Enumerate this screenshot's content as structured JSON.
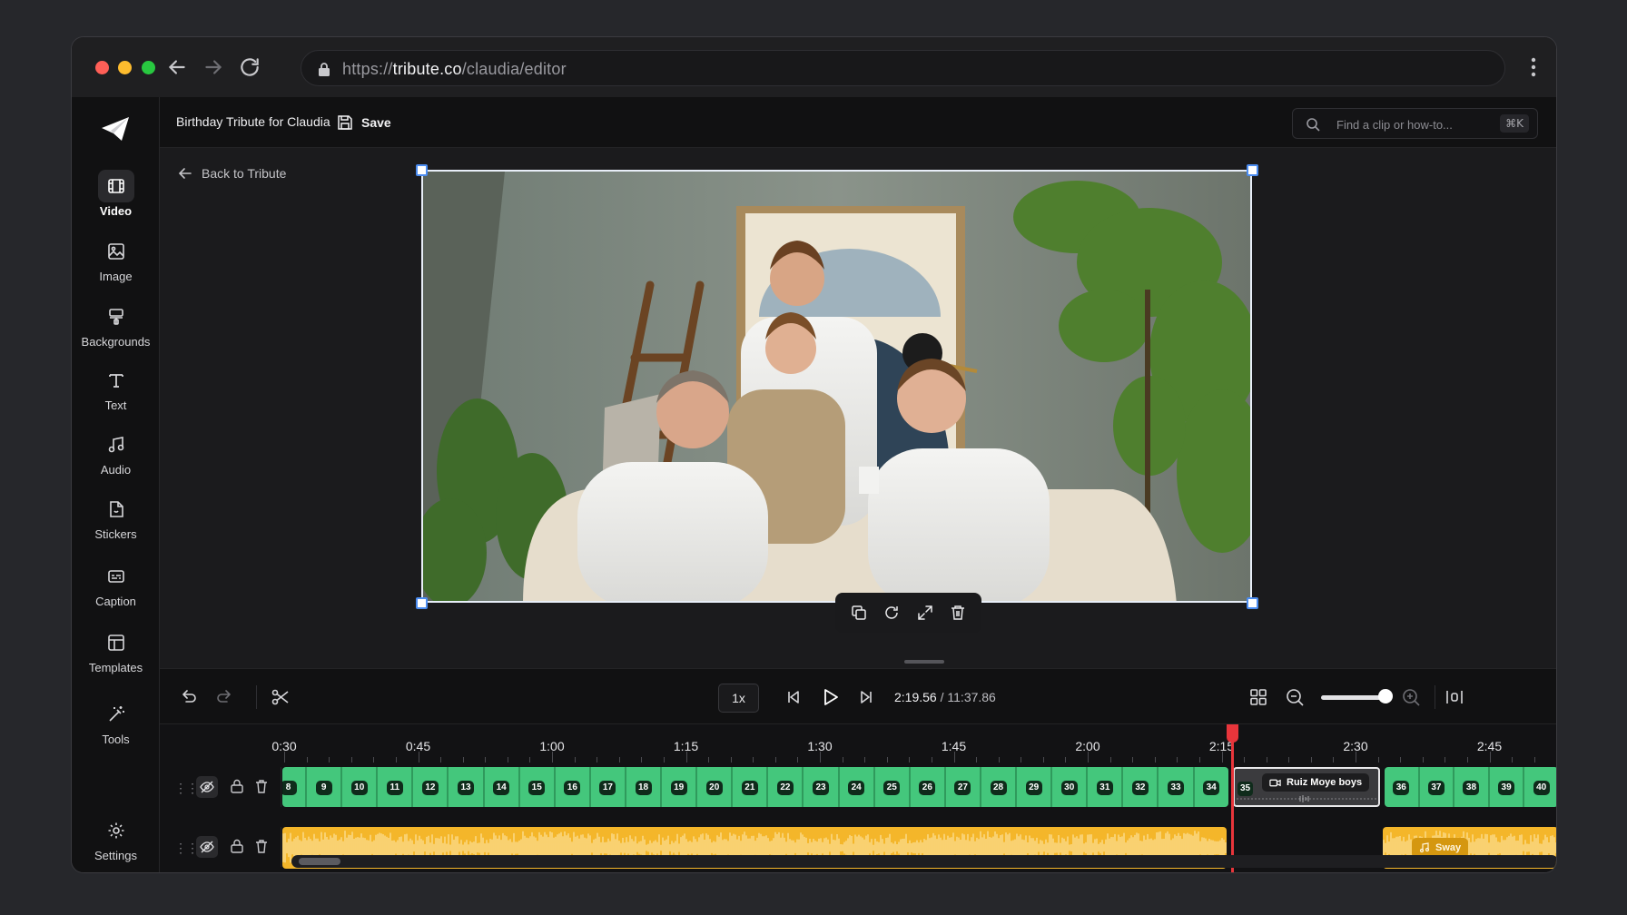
{
  "browser": {
    "url_domain": "tribute.co",
    "url_prefix": "https://",
    "url_path": "/claudia/editor"
  },
  "sidebar": {
    "items": [
      {
        "label": "Video",
        "icon": "film-icon",
        "active": true
      },
      {
        "label": "Image",
        "icon": "image-icon"
      },
      {
        "label": "Backgrounds",
        "icon": "paint-roller-icon"
      },
      {
        "label": "Text",
        "icon": "text-icon"
      },
      {
        "label": "Audio",
        "icon": "music-note-icon"
      },
      {
        "label": "Stickers",
        "icon": "sticker-icon"
      },
      {
        "label": "Caption",
        "icon": "caption-icon"
      },
      {
        "label": "Templates",
        "icon": "template-icon"
      },
      {
        "label": "Tools",
        "icon": "magic-wand-icon"
      }
    ],
    "settings_label": "Settings"
  },
  "topbar": {
    "project_title": "Birthday Tribute for Claudia",
    "save_label": "Save",
    "search_placeholder": "Find a clip or how-to...",
    "search_shortcut": "⌘K"
  },
  "canvas": {
    "back_label": "Back to Tribute"
  },
  "playback": {
    "speed": "1x",
    "current_time": "2:19.56",
    "separator": " / ",
    "total_time": "11:37.86",
    "zoom_level": 0.93
  },
  "ruler": {
    "labels": [
      "0:30",
      "0:45",
      "1:00",
      "1:15",
      "1:30",
      "1:45",
      "2:00",
      "2:15",
      "2:30",
      "2:45"
    ]
  },
  "video_track": {
    "clips_before": [
      "8",
      "9",
      "10",
      "11",
      "12",
      "13",
      "14",
      "15",
      "16",
      "17",
      "18",
      "19",
      "20",
      "21",
      "22",
      "23",
      "24",
      "25",
      "26",
      "27",
      "28",
      "29",
      "30",
      "31",
      "32",
      "33",
      "34"
    ],
    "selected_clip_number": "35",
    "selected_clip_label": "Ruiz Moye boys",
    "clips_after": [
      "36",
      "37",
      "38",
      "39",
      "40"
    ]
  },
  "audio_track": {
    "second_clip_label": "Sway"
  },
  "colors": {
    "accent_green": "#44c77c",
    "audio_yellow": "#f4b62a",
    "playhead_red": "#e8353b",
    "selection_blue": "#4b8cf0"
  }
}
